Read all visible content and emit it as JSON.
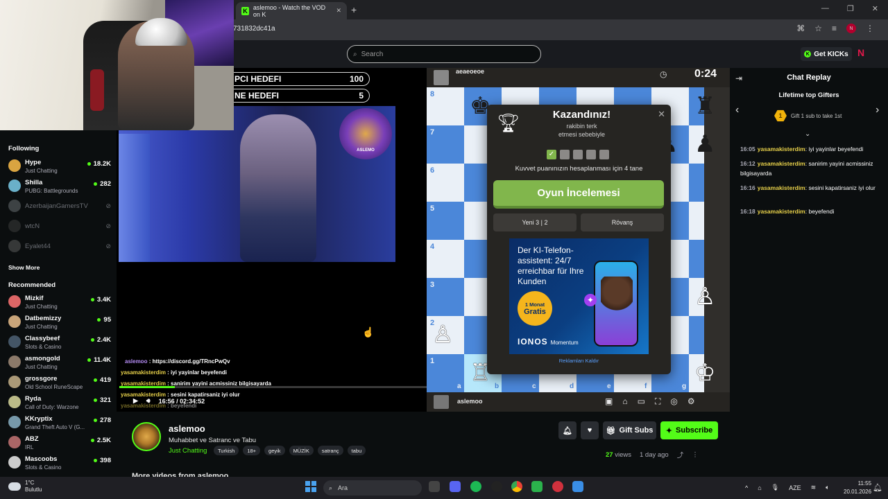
{
  "browser": {
    "tab_title": "aslemoo - Watch the VOD on K",
    "tab_icon": "K",
    "url": "731832dc41a",
    "new_tab": "+"
  },
  "topbar": {
    "search_placeholder": "Search",
    "get_kicks": "Get KICKs"
  },
  "sidebar": {
    "following_title": "Following",
    "following": [
      {
        "name": "Hype",
        "category": "Just Chatting",
        "viewers": "18.2K",
        "color": "#d9a441"
      },
      {
        "name": "Shilla",
        "category": "PUBG: Battlegrounds",
        "viewers": "282",
        "color": "#6ab0c9"
      },
      {
        "name": "AzerbaijanGamersTV",
        "offline": true,
        "color": "#9aa2a8"
      },
      {
        "name": "wtcN",
        "offline": true,
        "color": "#555"
      },
      {
        "name": "Eyalet44",
        "offline": true,
        "color": "#888"
      }
    ],
    "show_more": "Show More",
    "recommended_title": "Recommended",
    "recommended": [
      {
        "name": "Mizkif",
        "category": "Just Chatting",
        "viewers": "3.4K",
        "color": "#d66"
      },
      {
        "name": "Datbemizzy",
        "category": "Just Chatting",
        "viewers": "95",
        "color": "#c9a57a"
      },
      {
        "name": "Classybeef",
        "category": "Slots & Casino",
        "viewers": "2.4K",
        "color": "#456"
      },
      {
        "name": "asmongold",
        "category": "Just Chatting",
        "viewers": "11.4K",
        "color": "#8c7a6a"
      },
      {
        "name": "grossgore",
        "category": "Old School RuneScape",
        "viewers": "419",
        "color": "#a97"
      },
      {
        "name": "Ryda",
        "category": "Call of Duty: Warzone",
        "viewers": "321",
        "color": "#bb8"
      },
      {
        "name": "KKryptix",
        "category": "Grand Theft Auto V (G...",
        "viewers": "278",
        "color": "#79a"
      },
      {
        "name": "ABZ",
        "category": "IRL",
        "viewers": "2.5K",
        "color": "#a66"
      },
      {
        "name": "Mascoobs",
        "category": "Slots & Casino",
        "viewers": "398",
        "color": "#ccc"
      }
    ]
  },
  "overlay": {
    "goal1_label": "PCI HEDEFI",
    "goal1_value": "100",
    "goal2_label": "NE HEDEFI",
    "goal2_value": "5",
    "lion_text": "ASLEMO"
  },
  "video_chat": [
    {
      "user": "aslemoo",
      "text": " : https://discord.gg/TRncPwQv",
      "owner": true
    },
    {
      "user": "yasamakisterdim",
      "text": " : iyi yayinlar beyefendi"
    },
    {
      "user": "yasamakisterdim",
      "text": " : sanirim yayini acmissiniz bilgisayarda"
    },
    {
      "user": "yasamakisterdim",
      "text": " : sesini kapatirsaniz iyi olur"
    },
    {
      "user": "yasamakisterdim",
      "text": " : beyefendi"
    }
  ],
  "player": {
    "time": "16:56 / 02:34:52",
    "progress_fraction": 0.18
  },
  "chess": {
    "opponent": "aeaeoeoe",
    "opponent_flag": "🇹🇷",
    "timer": "0:24",
    "me": "aslemoo",
    "ranks": [
      "8",
      "7",
      "6",
      "5",
      "4",
      "3",
      "2",
      "1"
    ],
    "files": [
      "a",
      "b",
      "c",
      "d",
      "e",
      "f",
      "g"
    ],
    "result_title": "Kazandınız!",
    "result_sub1": "rakibin terk",
    "result_sub2": "etmesi sebebiyle",
    "boxes_label": "Kuvvet puanınızın hesaplanması için 4 tane",
    "review_button": "Oyun İncelemesi",
    "new_game": "Yeni 3 | 2",
    "rematch": "Rövanş",
    "remove_ads": "Reklamları Kaldır"
  },
  "ad": {
    "headline": "Der KI-Telefon-assistent: 24/7 erreichbar für Ihre Kunden",
    "badge_top": "1 Monat",
    "badge_main": "Gratis",
    "brand": "IONOS",
    "brand_sub": "Momentum"
  },
  "chat_replay": {
    "title": "Chat Replay",
    "gifters_title": "Lifetime top Gifters",
    "gift_rank": "1",
    "gift_text": "Gift 1 sub to take 1st",
    "messages": [
      {
        "time": "16:05",
        "user": "yasamakisterdim",
        "text": ": iyi yayinlar beyefendi"
      },
      {
        "time": "16:12",
        "user": "yasamakisterdim",
        "text": ": sanirim yayini acmissiniz bilgisayarda"
      },
      {
        "time": "16:16",
        "user": "yasamakisterdim",
        "text": ": sesini kapatirsaniz iyi olur"
      },
      {
        "time": "16:18",
        "user": "yasamakisterdim",
        "text": ": beyefendi"
      }
    ]
  },
  "channel": {
    "name": "aslemoo",
    "title": "Muhabbet ve Satranc ve Tabu",
    "category": "Just Chatting",
    "tags": [
      "Turkish",
      "18+",
      "geyik",
      "MÜZİK",
      "satranç",
      "tabu"
    ],
    "gift_subs": "Gift Subs",
    "subscribe": "Subscribe",
    "views_count": "27",
    "views_label": "views",
    "age": "1 day ago",
    "more_videos": "More videos from aslemoo"
  },
  "taskbar": {
    "temp": "1°C",
    "weather": "Bulutlu",
    "search_placeholder": "Ara",
    "lang": "AZE",
    "time": "11:55",
    "date": "20.01.2026"
  }
}
